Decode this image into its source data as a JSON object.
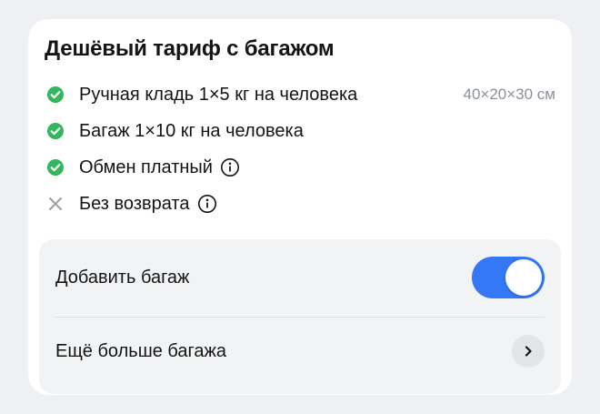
{
  "card": {
    "title": "Дешёвый тариф с багажом",
    "features": [
      {
        "label": "Ручная кладь 1×5 кг на человека",
        "note": "40×20×30 см",
        "status": "included",
        "icon": "check-circle-icon"
      },
      {
        "label": "Багаж 1×10 кг на человека",
        "status": "included",
        "icon": "check-circle-icon"
      },
      {
        "label": "Обмен платный",
        "status": "included",
        "icon": "check-circle-icon",
        "info": true
      },
      {
        "label": "Без возврата",
        "status": "excluded",
        "icon": "cross-icon",
        "info": true
      }
    ]
  },
  "options": {
    "add_baggage_label": "Добавить багаж",
    "add_baggage_enabled": true,
    "more_baggage_label": "Ещё больше багажа"
  },
  "colors": {
    "check": "#34b55f",
    "cross": "#9aa0a8",
    "toggle_on": "#3478f6",
    "note": "#8a8f98"
  }
}
